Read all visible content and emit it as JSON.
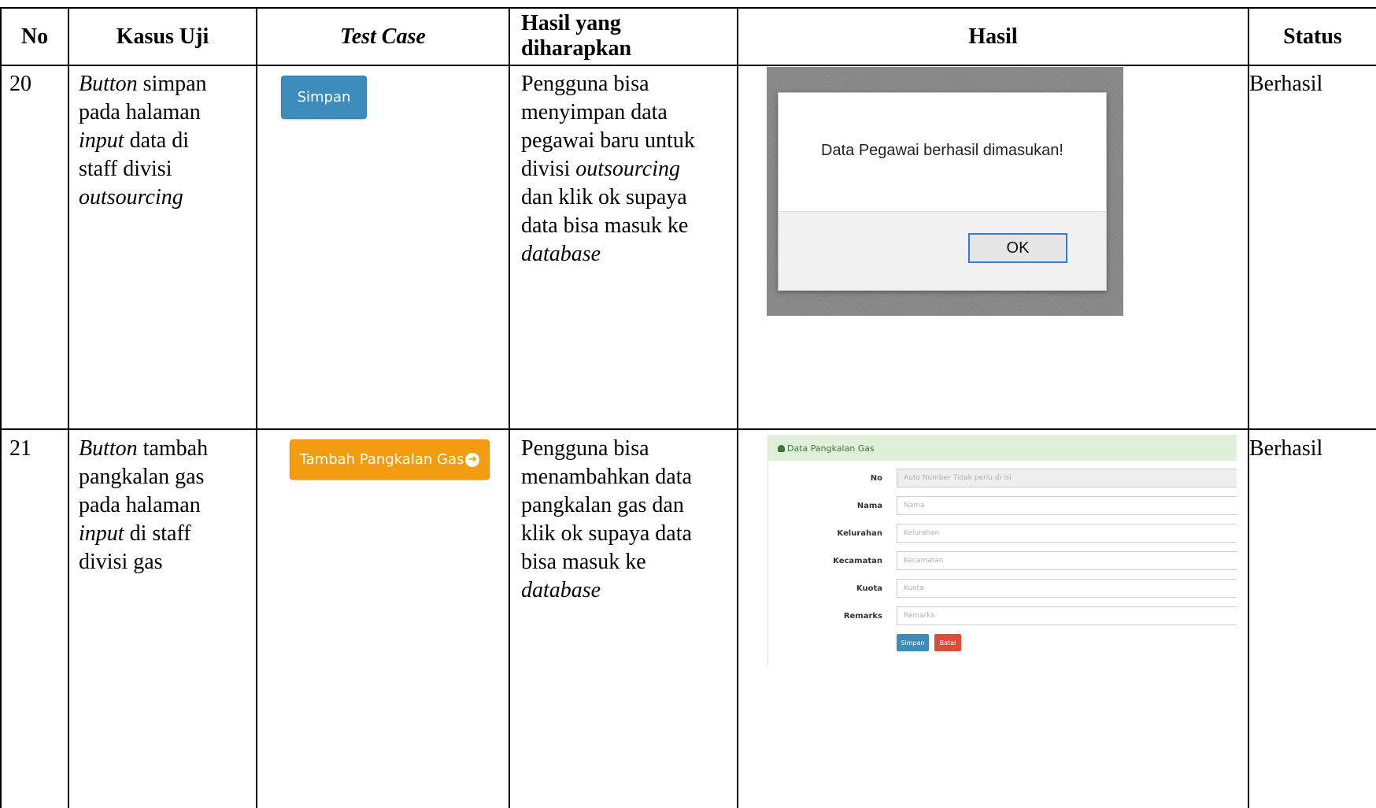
{
  "headers": {
    "no": "No",
    "kasus_uji": "Kasus Uji",
    "test_case": "Test Case",
    "hasil_diharapkan_1": "Hasil yang",
    "hasil_diharapkan_2": "diharapkan",
    "hasil": "Hasil",
    "status": "Status"
  },
  "rows": [
    {
      "no": "20",
      "kasus": {
        "l1a": "Button",
        "l1b": " simpan",
        "l2": "pada halaman",
        "l3a": "input",
        "l3b": " data di",
        "l4": "staff divisi",
        "l5": "outsourcing"
      },
      "test_case_button": "Simpan",
      "expected": {
        "l1": "Pengguna bisa",
        "l2": "menyimpan data",
        "l3": "pegawai baru untuk",
        "l4a": "divisi ",
        "l4b": "outsourcing",
        "l5": "dan klik ok supaya",
        "l6": "data bisa masuk ke",
        "l7": "database"
      },
      "dialog": {
        "message": "Data Pegawai berhasil dimasukan!",
        "ok": "OK"
      },
      "status": "Berhasil"
    },
    {
      "no": "21",
      "kasus": {
        "l1a": "Button",
        "l1b": " tambah",
        "l2": "pangkalan gas",
        "l3": "pada halaman",
        "l4a": "input",
        "l4b": " di staff",
        "l5": "divisi gas"
      },
      "test_case_button": "Tambah Pangkalan Gas",
      "expected": {
        "l1": "Pengguna bisa",
        "l2": "menambahkan data",
        "l3": "pangkalan gas dan",
        "l4": "klik ok supaya data",
        "l5": "bisa masuk ke",
        "l6": "database"
      },
      "form": {
        "title": "Data Pangkalan Gas",
        "fields": [
          {
            "label": "No",
            "placeholder": "Auto Number Tidak perlu di isi"
          },
          {
            "label": "Nama",
            "placeholder": "Nama"
          },
          {
            "label": "Kelurahan",
            "placeholder": "Kelurahan"
          },
          {
            "label": "Kecamatan",
            "placeholder": "Kecamatan"
          },
          {
            "label": "Kuota",
            "placeholder": "Kuota"
          },
          {
            "label": "Remarks",
            "placeholder": "Remarks"
          }
        ],
        "simpan": "Simpan",
        "batal": "Batal"
      },
      "status": "Berhasil"
    }
  ]
}
